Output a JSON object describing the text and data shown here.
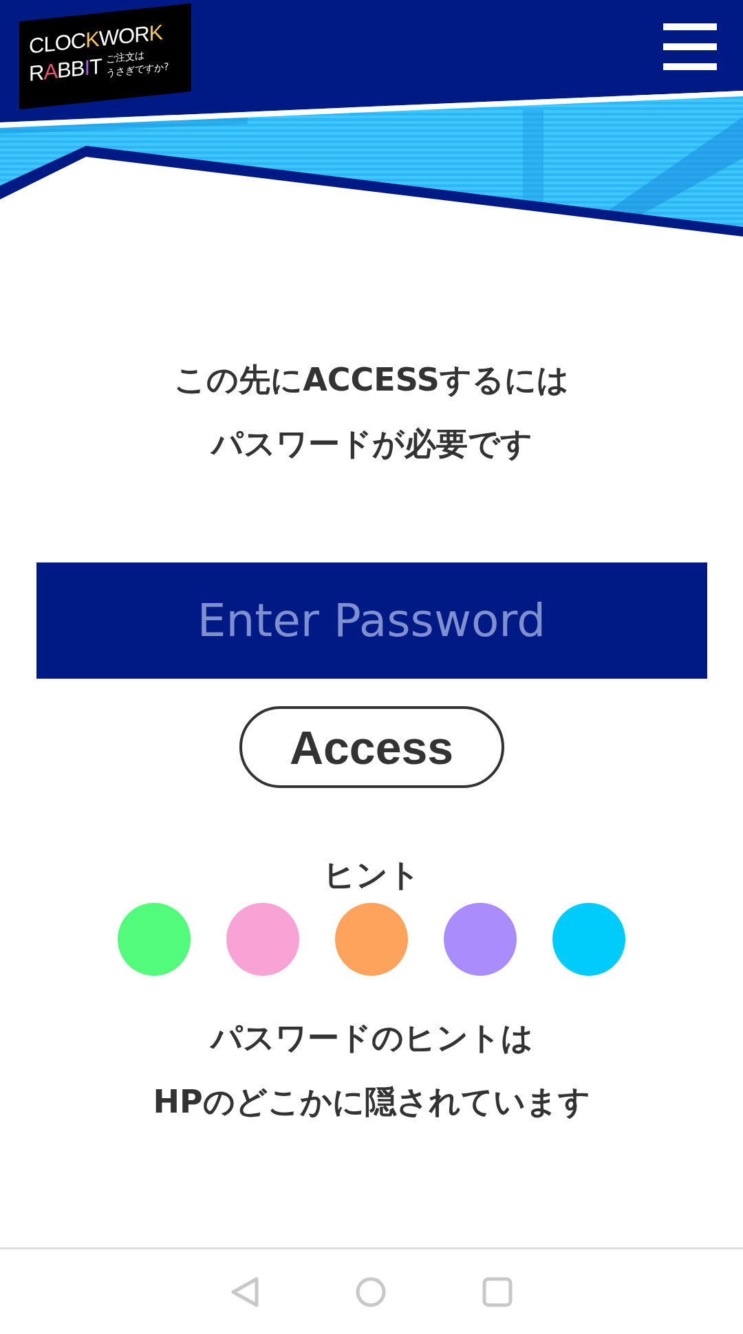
{
  "logo": {
    "title_lines": [
      [
        {
          "text": "CLOC",
          "color": "#ffffff"
        },
        {
          "text": "K",
          "color": "#f5c25a"
        },
        {
          "text": "WOR",
          "color": "#ffffff"
        },
        {
          "text": "K",
          "color": "#f5c25a"
        }
      ],
      [
        {
          "text": "R",
          "color": "#ffffff"
        },
        {
          "text": "A",
          "color": "#e8526f"
        },
        {
          "text": "BB",
          "color": "#ffffff"
        },
        {
          "text": "I",
          "color": "#a35ad8"
        },
        {
          "text": "T",
          "color": "#ffffff"
        }
      ]
    ],
    "subtitle_lines": [
      "ご注文は",
      "うさぎですか?"
    ]
  },
  "message_lines": [
    "この先にACCESSするには",
    "パスワードが必要です"
  ],
  "password": {
    "placeholder": "Enter Password"
  },
  "access_button": "Access",
  "hint_label": "ヒント",
  "hint_dots": [
    {
      "color": "#52fb7c"
    },
    {
      "color": "#f8a2d6"
    },
    {
      "color": "#fea35c"
    },
    {
      "color": "#aa8cfc"
    },
    {
      "color": "#00ccfc"
    }
  ],
  "hint_lines": [
    "パスワードのヒントは",
    "HPのどこかに隠されています"
  ]
}
